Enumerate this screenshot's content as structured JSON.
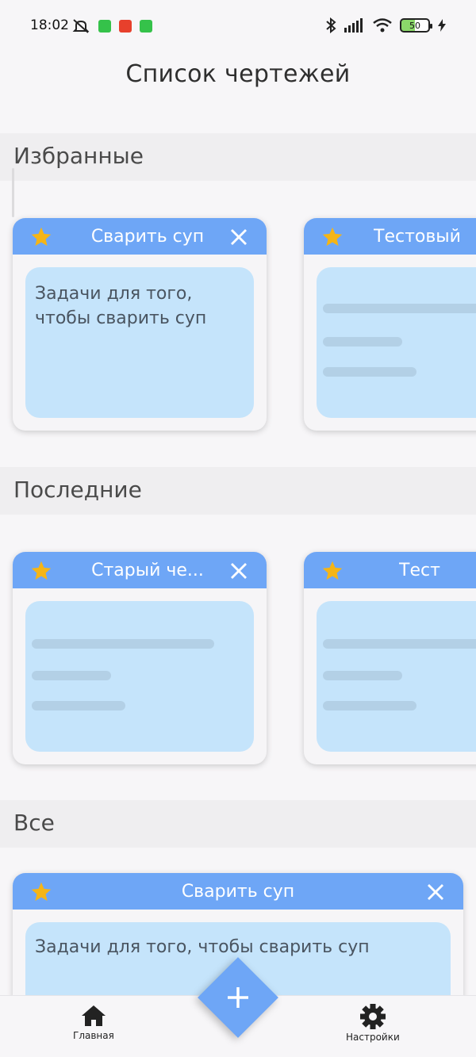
{
  "status_bar": {
    "time": "18:02",
    "battery": "50"
  },
  "title": "Список чертежей",
  "sections": {
    "favorites": "Избранные",
    "recent": "Последние",
    "all": "Все"
  },
  "favorites_cards": [
    {
      "title": "Сварить суп",
      "body": "Задачи для того, чтобы сварить суп",
      "starred": true,
      "closable": true
    },
    {
      "title": "Тестовый",
      "body": "",
      "starred": true,
      "closable": false
    }
  ],
  "recent_cards": [
    {
      "title": "Старый че...",
      "body": "",
      "starred": true,
      "closable": true
    },
    {
      "title": "Тест",
      "body": "",
      "starred": true,
      "closable": false
    }
  ],
  "all_cards": [
    {
      "title": "Сварить суп",
      "body": "Задачи для того, чтобы сварить суп",
      "starred": true,
      "closable": true
    }
  ],
  "bottom_nav": {
    "home": "Главная",
    "settings": "Настройки"
  },
  "icons": [
    "star-icon",
    "close-icon",
    "add-icon",
    "home-icon",
    "settings-icon"
  ],
  "colors": {
    "accent": "#6ea6f6",
    "card_body": "#c5e4fb",
    "star": "#f5b516"
  }
}
